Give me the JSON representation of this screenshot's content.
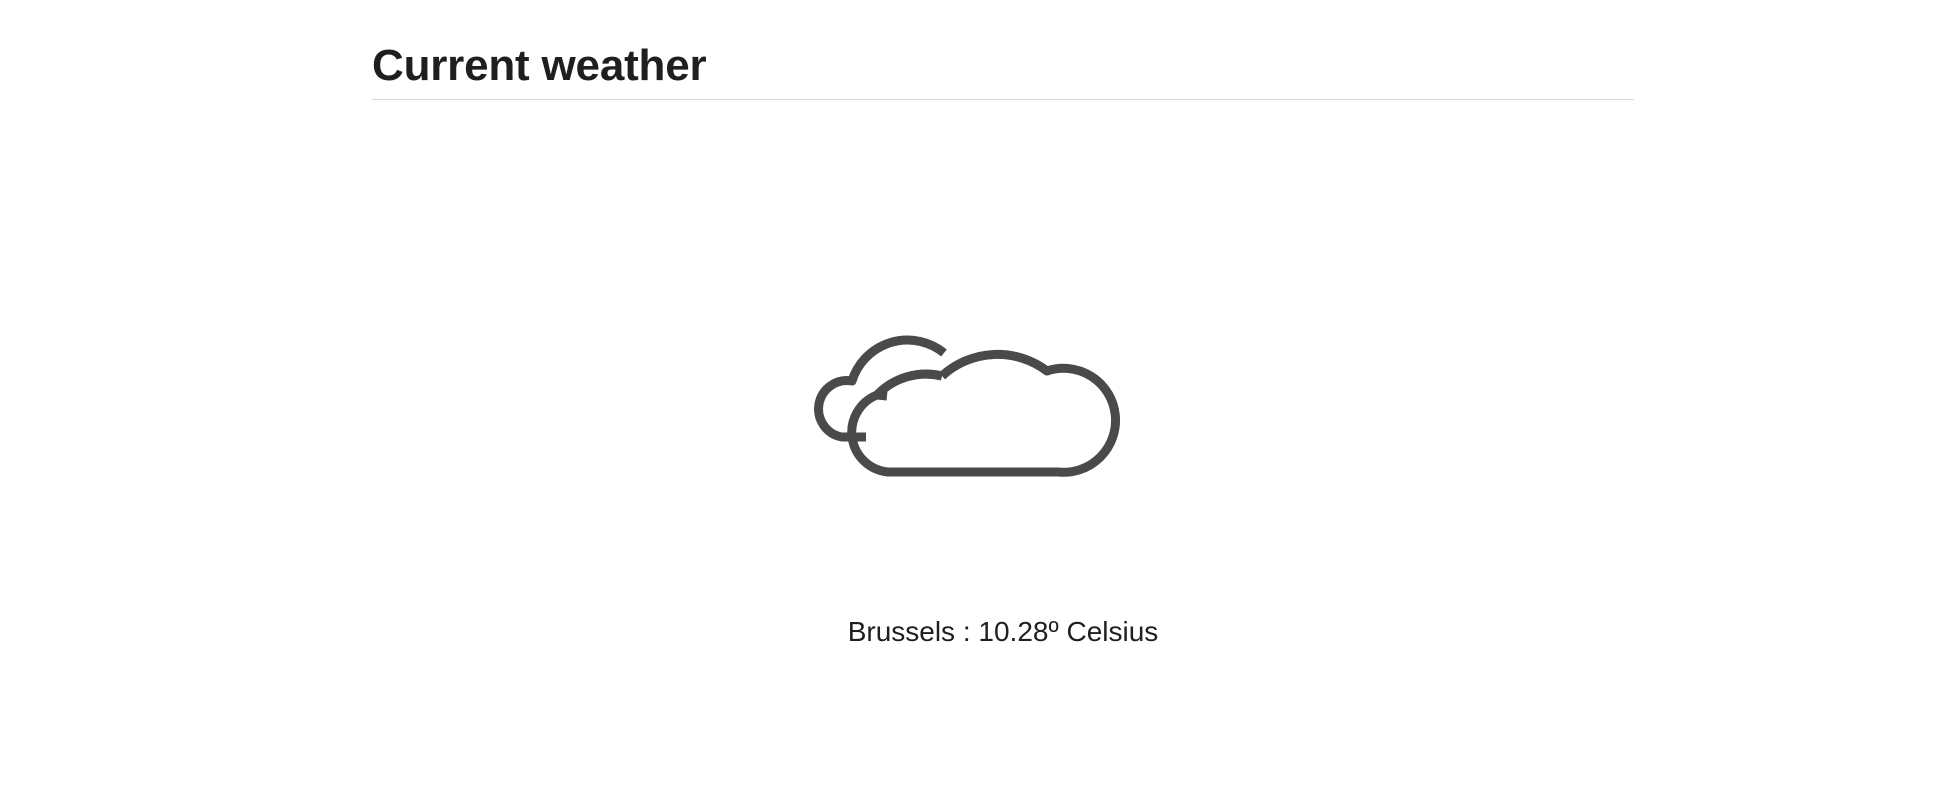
{
  "header": {
    "title": "Current weather"
  },
  "weather": {
    "icon": "cloudy-icon",
    "city": "Brussels",
    "separator": " : ",
    "temperature": "10.28º",
    "unit": " Celsius"
  },
  "colors": {
    "icon_stroke": "#4a4a4a",
    "divider": "#d9d9d9",
    "text": "#1f1f1f",
    "background": "#ffffff"
  }
}
